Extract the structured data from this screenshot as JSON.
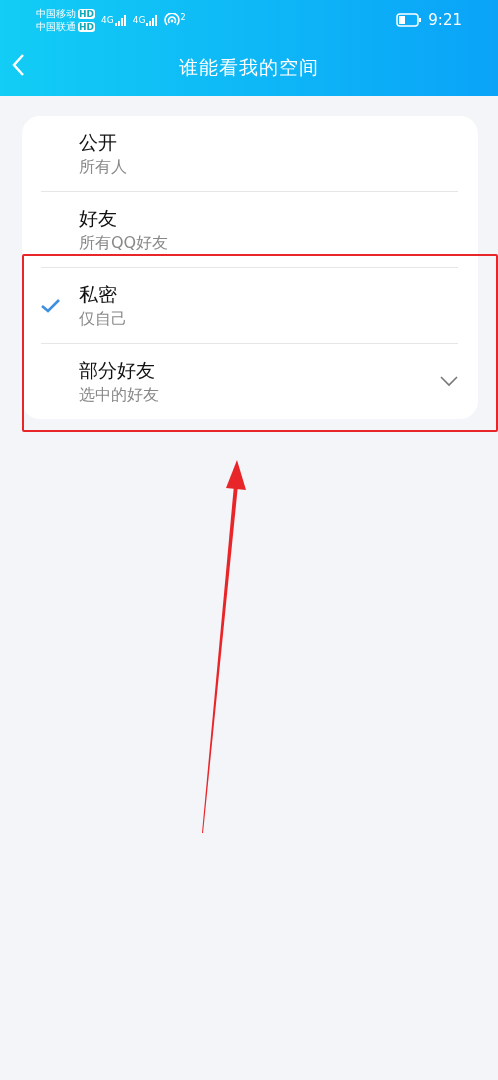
{
  "status_bar": {
    "carriers": [
      {
        "name": "中国移动",
        "badge": "HD"
      },
      {
        "name": "中国联通",
        "badge": "HD"
      }
    ],
    "signals": [
      {
        "network": "4G"
      },
      {
        "network": "4G"
      }
    ],
    "hotspot_count": "2",
    "time": "9:21"
  },
  "header": {
    "title": "谁能看我的空间"
  },
  "options": [
    {
      "title": "公开",
      "subtitle": "所有人",
      "selected": false,
      "expandable": false
    },
    {
      "title": "好友",
      "subtitle": "所有QQ好友",
      "selected": false,
      "expandable": false
    },
    {
      "title": "私密",
      "subtitle": "仅自己",
      "selected": true,
      "expandable": false
    },
    {
      "title": "部分好友",
      "subtitle": "选中的好友",
      "selected": false,
      "expandable": true
    }
  ]
}
